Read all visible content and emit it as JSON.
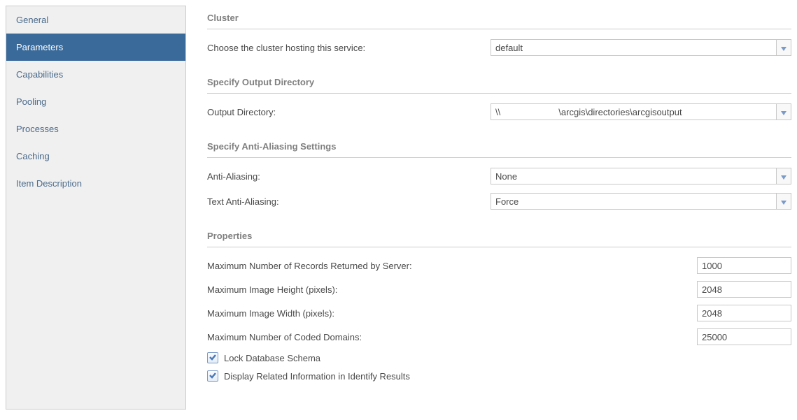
{
  "sidebar": {
    "items": [
      {
        "label": "General"
      },
      {
        "label": "Parameters"
      },
      {
        "label": "Capabilities"
      },
      {
        "label": "Pooling"
      },
      {
        "label": "Processes"
      },
      {
        "label": "Caching"
      },
      {
        "label": "Item Description"
      }
    ]
  },
  "sections": {
    "cluster": {
      "title": "Cluster",
      "choose_label": "Choose the cluster hosting this service:",
      "choose_value": "default"
    },
    "output": {
      "title": "Specify Output Directory",
      "dir_label": "Output Directory:",
      "dir_value": "\\\\                       \\arcgis\\directories\\arcgisoutput"
    },
    "antialias": {
      "title": "Specify Anti-Aliasing Settings",
      "aa_label": "Anti-Aliasing:",
      "aa_value": "None",
      "text_aa_label": "Text Anti-Aliasing:",
      "text_aa_value": "Force"
    },
    "properties": {
      "title": "Properties",
      "max_records_label": "Maximum Number of Records Returned by Server:",
      "max_records_value": "1000",
      "max_height_label": "Maximum Image Height (pixels):",
      "max_height_value": "2048",
      "max_width_label": "Maximum Image Width (pixels):",
      "max_width_value": "2048",
      "max_domains_label": "Maximum Number of Coded Domains:",
      "max_domains_value": "25000",
      "lock_schema_label": "Lock Database Schema",
      "display_related_label": "Display Related Information in Identify Results"
    }
  }
}
